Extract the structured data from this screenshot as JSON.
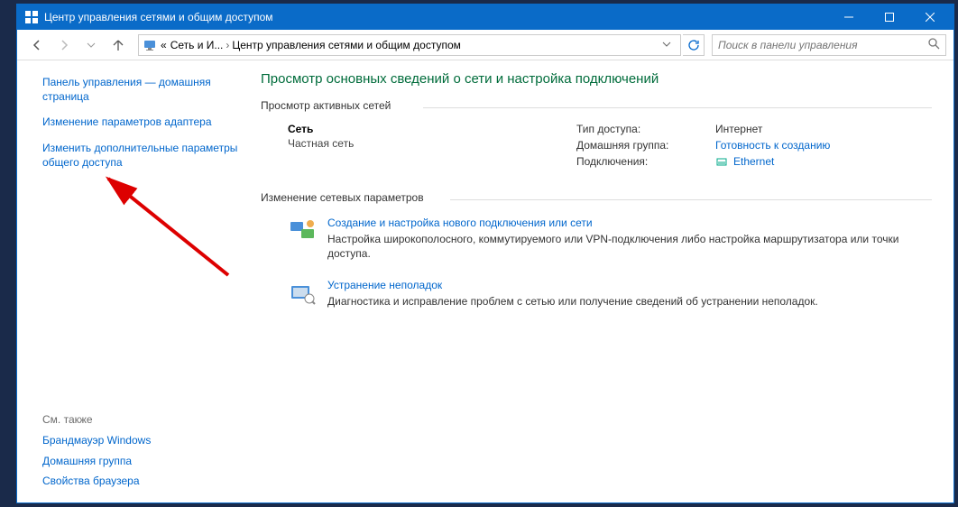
{
  "titlebar": {
    "title": "Центр управления сетями и общим доступом"
  },
  "breadcrumb": {
    "prefix": "«",
    "item1": "Сеть и И...",
    "item2": "Центр управления сетями и общим доступом"
  },
  "search": {
    "placeholder": "Поиск в панели управления"
  },
  "sidebar": {
    "home": "Панель управления — домашняя страница",
    "adapter": "Изменение параметров адаптера",
    "sharing": "Изменить дополнительные параметры общего доступа",
    "see_also": "См. также",
    "firewall": "Брандмауэр Windows",
    "homegroup": "Домашняя группа",
    "browser": "Свойства браузера"
  },
  "main": {
    "heading": "Просмотр основных сведений о сети и настройка подключений",
    "active_networks": "Просмотр активных сетей",
    "network": {
      "name": "Сеть",
      "subtype": "Частная сеть",
      "access_label": "Тип доступа:",
      "access_value": "Интернет",
      "homegroup_label": "Домашняя группа:",
      "homegroup_value": "Готовность к созданию",
      "conn_label": "Подключения:",
      "conn_value": "Ethernet"
    },
    "change_settings": "Изменение сетевых параметров",
    "action1": {
      "title": "Создание и настройка нового подключения или сети",
      "desc": "Настройка широкополосного, коммутируемого или VPN-подключения либо настройка маршрутизатора или точки доступа."
    },
    "action2": {
      "title": "Устранение неполадок",
      "desc": "Диагностика и исправление проблем с сетью или получение сведений об устранении неполадок."
    }
  }
}
